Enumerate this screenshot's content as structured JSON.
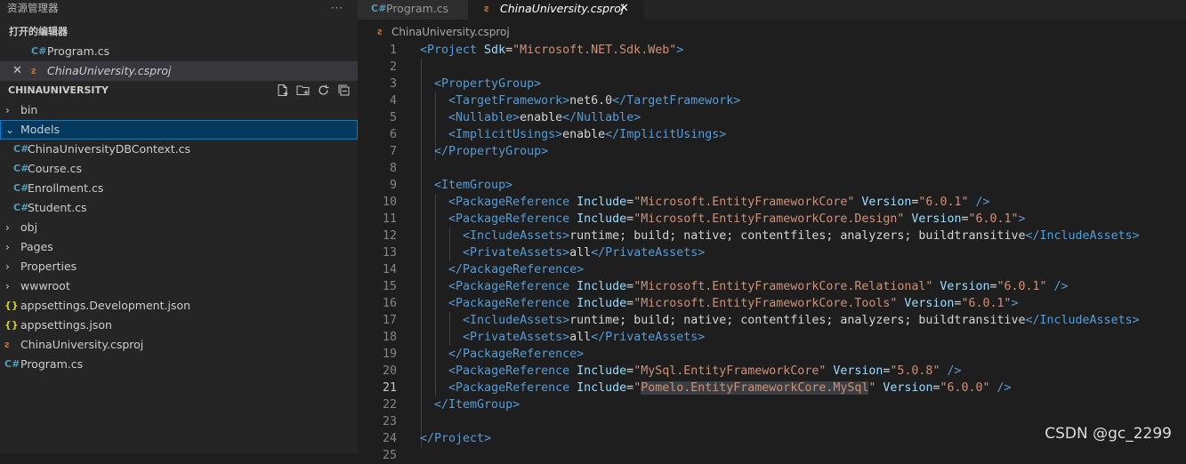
{
  "explorer": {
    "header": "资源管理器",
    "more": "···",
    "open_editors_title": "打开的编辑器",
    "open_editors": [
      {
        "label": "Program.cs",
        "icon": "C#"
      },
      {
        "label": "ChinaUniversity.csproj",
        "icon": "rss"
      }
    ],
    "close_glyph": "✕",
    "project_title": "CHINAUNIVERSITY",
    "tree": {
      "bin": "bin",
      "models": "Models",
      "model_files": [
        "ChinaUniversityDBContext.cs",
        "Course.cs",
        "Enrollment.cs",
        "Student.cs"
      ],
      "obj": "obj",
      "pages": "Pages",
      "properties": "Properties",
      "wwwroot": "wwwroot",
      "files": [
        "appsettings.Development.json",
        "appsettings.json",
        "ChinaUniversity.csproj",
        "Program.cs"
      ]
    }
  },
  "icons": {
    "cs": "C#",
    "json": "{}",
    "rss": "ᴤ",
    "chev_right": "›",
    "chev_down": "⌄"
  },
  "tabs": [
    {
      "label": "Program.cs",
      "active": false
    },
    {
      "label": "ChinaUniversity.csproj",
      "active": true
    }
  ],
  "breadcrumb": "ChinaUniversity.csproj",
  "current_line": 21,
  "code_lines": [
    [
      [
        "t",
        "<Project"
      ],
      [
        "a",
        " Sdk"
      ],
      [
        "d",
        "="
      ],
      [
        "s",
        "\"Microsoft.NET.Sdk.Web\""
      ],
      [
        "t",
        ">"
      ]
    ],
    [],
    [
      [
        "d",
        "  "
      ],
      [
        "t",
        "<PropertyGroup>"
      ]
    ],
    [
      [
        "d",
        "    "
      ],
      [
        "t",
        "<TargetFramework>"
      ],
      [
        "d",
        "net6.0"
      ],
      [
        "t",
        "</TargetFramework>"
      ]
    ],
    [
      [
        "d",
        "    "
      ],
      [
        "t",
        "<Nullable>"
      ],
      [
        "d",
        "enable"
      ],
      [
        "t",
        "</Nullable>"
      ]
    ],
    [
      [
        "d",
        "    "
      ],
      [
        "t",
        "<ImplicitUsings>"
      ],
      [
        "d",
        "enable"
      ],
      [
        "t",
        "</ImplicitUsings>"
      ]
    ],
    [
      [
        "d",
        "  "
      ],
      [
        "t",
        "</PropertyGroup>"
      ]
    ],
    [],
    [
      [
        "d",
        "  "
      ],
      [
        "t",
        "<ItemGroup>"
      ]
    ],
    [
      [
        "d",
        "    "
      ],
      [
        "t",
        "<PackageReference"
      ],
      [
        "a",
        " Include"
      ],
      [
        "d",
        "="
      ],
      [
        "s",
        "\"Microsoft.EntityFrameworkCore\""
      ],
      [
        "a",
        " Version"
      ],
      [
        "d",
        "="
      ],
      [
        "s",
        "\"6.0.1\""
      ],
      [
        "t",
        " />"
      ]
    ],
    [
      [
        "d",
        "    "
      ],
      [
        "t",
        "<PackageReference"
      ],
      [
        "a",
        " Include"
      ],
      [
        "d",
        "="
      ],
      [
        "s",
        "\"Microsoft.EntityFrameworkCore.Design\""
      ],
      [
        "a",
        " Version"
      ],
      [
        "d",
        "="
      ],
      [
        "s",
        "\"6.0.1\""
      ],
      [
        "t",
        ">"
      ]
    ],
    [
      [
        "d",
        "      "
      ],
      [
        "t",
        "<IncludeAssets>"
      ],
      [
        "d",
        "runtime; build; native; contentfiles; analyzers; buildtransitive"
      ],
      [
        "t",
        "</IncludeAssets>"
      ]
    ],
    [
      [
        "d",
        "      "
      ],
      [
        "t",
        "<PrivateAssets>"
      ],
      [
        "d",
        "all"
      ],
      [
        "t",
        "</PrivateAssets>"
      ]
    ],
    [
      [
        "d",
        "    "
      ],
      [
        "t",
        "</PackageReference>"
      ]
    ],
    [
      [
        "d",
        "    "
      ],
      [
        "t",
        "<PackageReference"
      ],
      [
        "a",
        " Include"
      ],
      [
        "d",
        "="
      ],
      [
        "s",
        "\"Microsoft.EntityFrameworkCore.Relational\""
      ],
      [
        "a",
        " Version"
      ],
      [
        "d",
        "="
      ],
      [
        "s",
        "\"6.0.1\""
      ],
      [
        "t",
        " />"
      ]
    ],
    [
      [
        "d",
        "    "
      ],
      [
        "t",
        "<PackageReference"
      ],
      [
        "a",
        " Include"
      ],
      [
        "d",
        "="
      ],
      [
        "s",
        "\"Microsoft.EntityFrameworkCore.Tools\""
      ],
      [
        "a",
        " Version"
      ],
      [
        "d",
        "="
      ],
      [
        "s",
        "\"6.0.1\""
      ],
      [
        "t",
        ">"
      ]
    ],
    [
      [
        "d",
        "      "
      ],
      [
        "t",
        "<IncludeAssets>"
      ],
      [
        "d",
        "runtime; build; native; contentfiles; analyzers; buildtransitive"
      ],
      [
        "t",
        "</IncludeAssets>"
      ]
    ],
    [
      [
        "d",
        "      "
      ],
      [
        "t",
        "<PrivateAssets>"
      ],
      [
        "d",
        "all"
      ],
      [
        "t",
        "</PrivateAssets>"
      ]
    ],
    [
      [
        "d",
        "    "
      ],
      [
        "t",
        "</PackageReference>"
      ]
    ],
    [
      [
        "d",
        "    "
      ],
      [
        "t",
        "<PackageReference"
      ],
      [
        "a",
        " Include"
      ],
      [
        "d",
        "="
      ],
      [
        "s",
        "\"MySql.EntityFrameworkCore\""
      ],
      [
        "a",
        " Version"
      ],
      [
        "d",
        "="
      ],
      [
        "s",
        "\"5.0.8\""
      ],
      [
        "t",
        " />"
      ]
    ],
    [
      [
        "d",
        "    "
      ],
      [
        "t",
        "<PackageReference"
      ],
      [
        "a",
        " Include"
      ],
      [
        "d",
        "="
      ],
      [
        "s",
        "\""
      ],
      [
        "sh",
        "Pomelo.EntityFrameworkCore.MySql"
      ],
      [
        "s",
        "\""
      ],
      [
        "a",
        " Version"
      ],
      [
        "d",
        "="
      ],
      [
        "s",
        "\"6.0.0\""
      ],
      [
        "t",
        " />"
      ]
    ],
    [
      [
        "d",
        "  "
      ],
      [
        "t",
        "</ItemGroup>"
      ]
    ],
    [],
    [
      [
        "t",
        "</Project>"
      ]
    ],
    []
  ],
  "watermark": "CSDN @gc_2299"
}
